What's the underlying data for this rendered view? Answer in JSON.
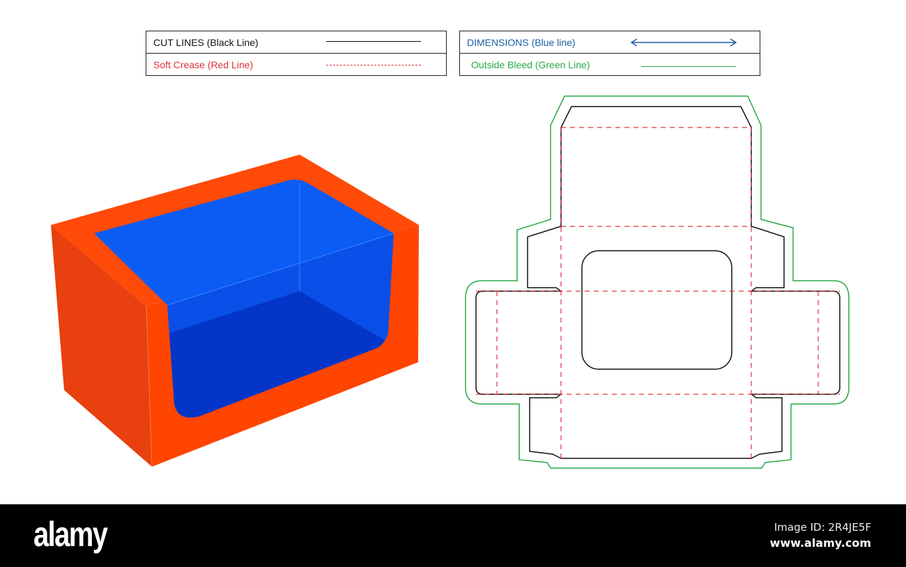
{
  "legend": {
    "cut_lines": "CUT LINES (Black Line)",
    "soft_crease": "Soft Crease (Red Line)",
    "dimensions": "DIMENSIONS (Blue line)",
    "outside_bleed": "Outside Bleed (Green Line)"
  },
  "colors": {
    "cut": "#111111",
    "crease": "#e0303a",
    "dimension": "#1a5fa0",
    "bleed": "#2aa84a",
    "box_front": "#ff4500",
    "box_side": "#e8400f",
    "box_inner": "#0a5cf5",
    "box_floor": "#0336c8"
  },
  "footer": {
    "logo": "alamy",
    "image_id": "Image ID: 2R4JE5F",
    "site": "www.alamy.com"
  }
}
